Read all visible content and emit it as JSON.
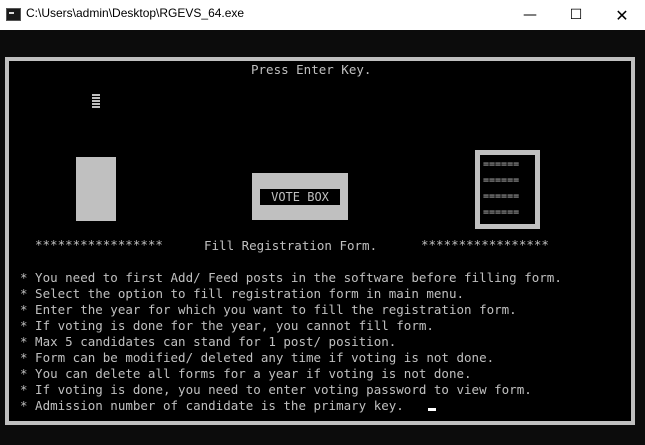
{
  "window": {
    "title": "C:\\Users\\admin\\Desktop\\RGEVS_64.exe",
    "minimize_glyph": "—",
    "maximize_glyph": "☐",
    "close_glyph": "✕"
  },
  "console": {
    "prompt": "Press Enter Key.",
    "vote_box_label": "VOTE BOX",
    "ballot_lines": [
      "======",
      "======",
      "======",
      "======"
    ],
    "stars_left": "*****************",
    "heading": "Fill Registration Form.",
    "stars_right": "*****************",
    "instructions": [
      "* You need to first Add/ Feed posts in the software before filling form.",
      "* Select the option to fill registration form in main menu.",
      "* Enter the year for which you want to fill the registration form.",
      "* If voting is done for the year, you cannot fill form.",
      "* Max 5 candidates can stand for 1 post/ position.",
      "* Form can be modified/ deleted any time if voting is not done.",
      "* You can delete all forms for a year if voting is not done.",
      "* If voting is done, you need to enter voting password to view form.",
      "* Admission number of candidate is the primary key."
    ]
  }
}
